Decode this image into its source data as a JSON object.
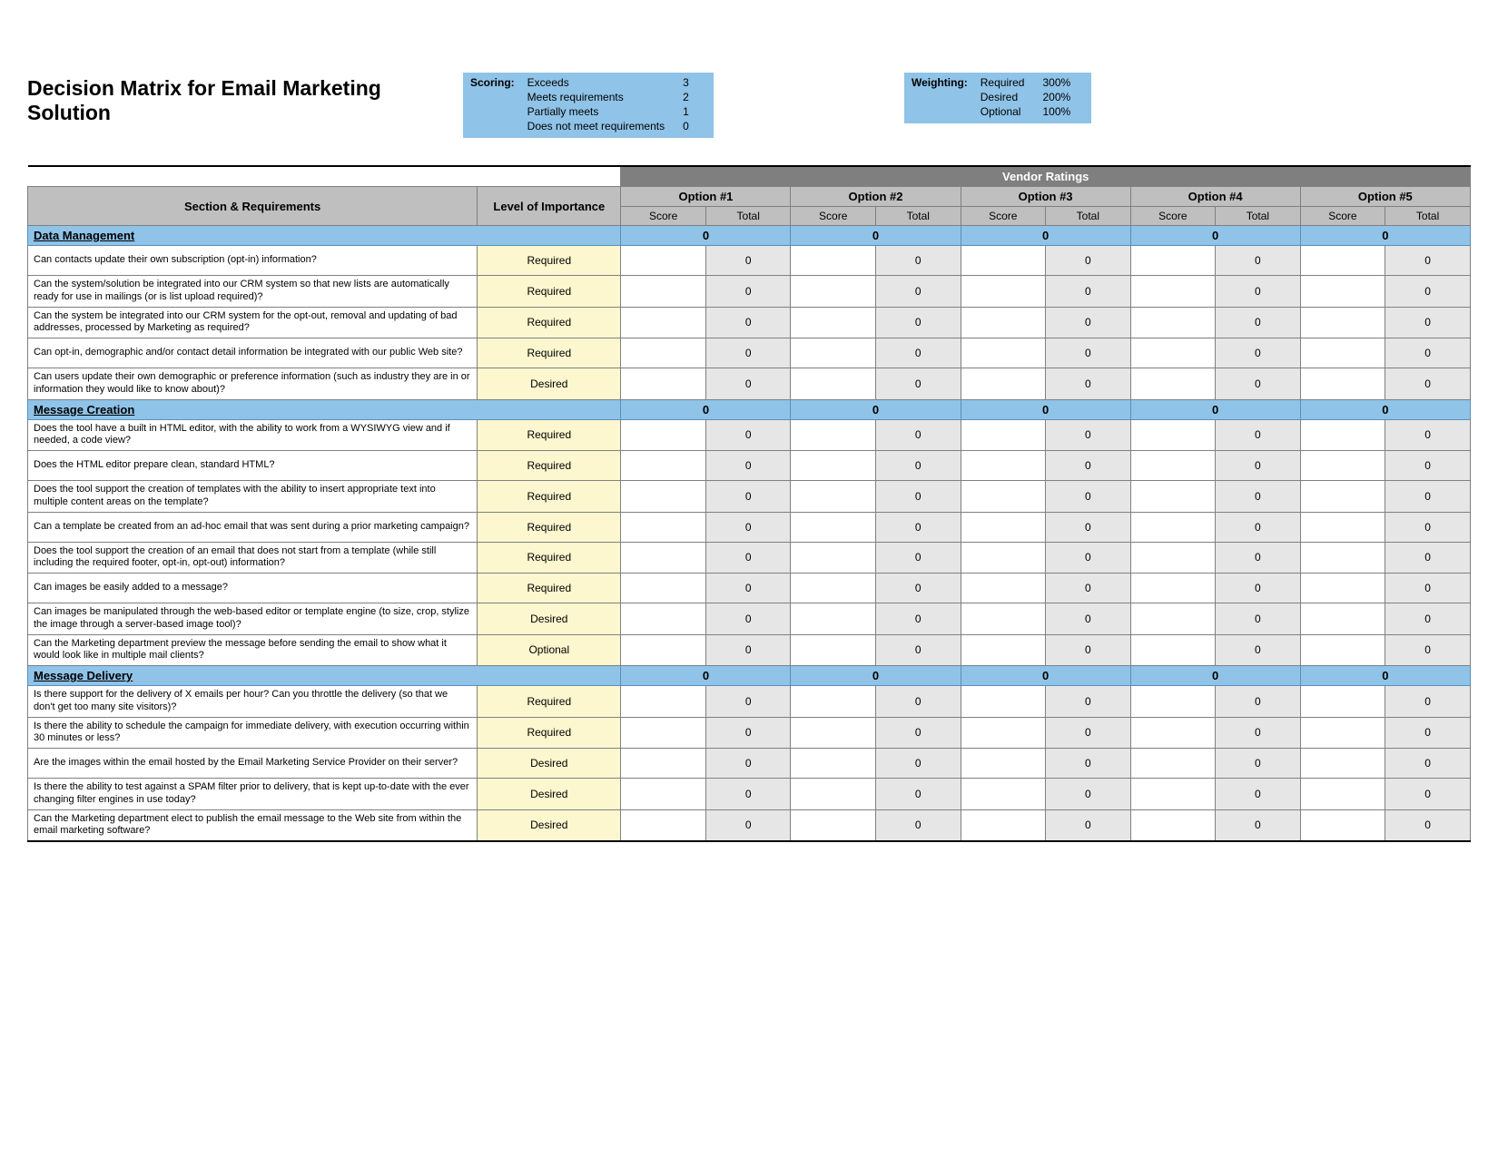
{
  "title": "Decision Matrix for Email Marketing Solution",
  "scoring": {
    "label": "Scoring:",
    "rows": [
      {
        "name": "Exceeds",
        "val": "3"
      },
      {
        "name": "Meets requirements",
        "val": "2"
      },
      {
        "name": "Partially meets",
        "val": "1"
      },
      {
        "name": "Does not meet requirements",
        "val": "0"
      }
    ]
  },
  "weighting": {
    "label": "Weighting:",
    "rows": [
      {
        "name": "Required",
        "val": "300%"
      },
      {
        "name": "Desired",
        "val": "200%"
      },
      {
        "name": "Optional",
        "val": "100%"
      }
    ]
  },
  "headers": {
    "vendor_ratings": "Vendor Ratings",
    "section_req": "Section & Requirements",
    "importance": "Level of Importance",
    "options": [
      "Option #1",
      "Option #2",
      "Option #3",
      "Option #4",
      "Option #5"
    ],
    "score": "Score",
    "total": "Total"
  },
  "levels": {
    "required": "Required",
    "desired": "Desired",
    "optional": "Optional"
  },
  "option_count": 5,
  "sections": [
    {
      "name": "Data Management",
      "totals": [
        "0",
        "0",
        "0",
        "0",
        "0"
      ],
      "rows": [
        {
          "req": "Can contacts update their own subscription (opt-in) information?",
          "imp": "required",
          "totals": [
            "0",
            "0",
            "0",
            "0",
            "0"
          ]
        },
        {
          "req": "Can the system/solution be integrated into our CRM system so that new lists are automatically ready for use in mailings (or is list upload required)?",
          "imp": "required",
          "totals": [
            "0",
            "0",
            "0",
            "0",
            "0"
          ]
        },
        {
          "req": "Can the system be integrated into our CRM system for the opt-out, removal and updating of bad addresses, processed by Marketing as required?",
          "imp": "required",
          "totals": [
            "0",
            "0",
            "0",
            "0",
            "0"
          ]
        },
        {
          "req": "Can opt-in, demographic and/or contact detail information be integrated with our public Web site?",
          "imp": "required",
          "totals": [
            "0",
            "0",
            "0",
            "0",
            "0"
          ]
        },
        {
          "req": "Can users update their own demographic or preference information (such as industry they are in or information they would like to know about)?",
          "imp": "desired",
          "totals": [
            "0",
            "0",
            "0",
            "0",
            "0"
          ]
        }
      ]
    },
    {
      "name": "Message Creation",
      "totals": [
        "0",
        "0",
        "0",
        "0",
        "0"
      ],
      "rows": [
        {
          "req": "Does the tool have a built in HTML editor, with the ability to work from a WYSIWYG view and if needed, a code view?",
          "imp": "required",
          "totals": [
            "0",
            "0",
            "0",
            "0",
            "0"
          ]
        },
        {
          "req": "Does the HTML editor prepare clean, standard HTML?",
          "imp": "required",
          "totals": [
            "0",
            "0",
            "0",
            "0",
            "0"
          ]
        },
        {
          "req": "Does the tool support the creation of templates with the ability to insert appropriate text into multiple content areas on the template?",
          "imp": "required",
          "totals": [
            "0",
            "0",
            "0",
            "0",
            "0"
          ]
        },
        {
          "req": "Can a template be created from an ad-hoc email that was sent during a prior marketing campaign?",
          "imp": "required",
          "totals": [
            "0",
            "0",
            "0",
            "0",
            "0"
          ]
        },
        {
          "req": "Does the tool support the creation of an email that does not start from a template (while still including the required footer, opt-in, opt-out) information?",
          "imp": "required",
          "totals": [
            "0",
            "0",
            "0",
            "0",
            "0"
          ]
        },
        {
          "req": "Can images be easily added to a message?",
          "imp": "required",
          "totals": [
            "0",
            "0",
            "0",
            "0",
            "0"
          ]
        },
        {
          "req": "Can images be manipulated through the web-based editor or template engine (to size, crop, stylize the image through a server-based image tool)?",
          "imp": "desired",
          "totals": [
            "0",
            "0",
            "0",
            "0",
            "0"
          ]
        },
        {
          "req": "Can the Marketing department preview the message before sending the email to show what it would look like in multiple mail clients?",
          "imp": "optional",
          "totals": [
            "0",
            "0",
            "0",
            "0",
            "0"
          ]
        }
      ]
    },
    {
      "name": "Message Delivery",
      "totals": [
        "0",
        "0",
        "0",
        "0",
        "0"
      ],
      "rows": [
        {
          "req": "Is there support for the delivery of X emails per hour?  Can you throttle the delivery (so that we don't get too many site visitors)?",
          "imp": "required",
          "totals": [
            "0",
            "0",
            "0",
            "0",
            "0"
          ]
        },
        {
          "req": "Is there the ability to schedule the campaign for immediate delivery, with execution occurring within 30 minutes or less?",
          "imp": "required",
          "totals": [
            "0",
            "0",
            "0",
            "0",
            "0"
          ]
        },
        {
          "req": "Are the images within the email hosted by the Email Marketing Service Provider on their server?",
          "imp": "desired",
          "totals": [
            "0",
            "0",
            "0",
            "0",
            "0"
          ]
        },
        {
          "req": "Is there the ability to test against a SPAM filter prior to delivery, that is kept up-to-date with the ever changing filter engines in use today?",
          "imp": "desired",
          "totals": [
            "0",
            "0",
            "0",
            "0",
            "0"
          ]
        },
        {
          "req": "Can the Marketing department elect to publish the email message to the Web site from within the email marketing software?",
          "imp": "desired",
          "totals": [
            "0",
            "0",
            "0",
            "0",
            "0"
          ]
        }
      ]
    }
  ]
}
